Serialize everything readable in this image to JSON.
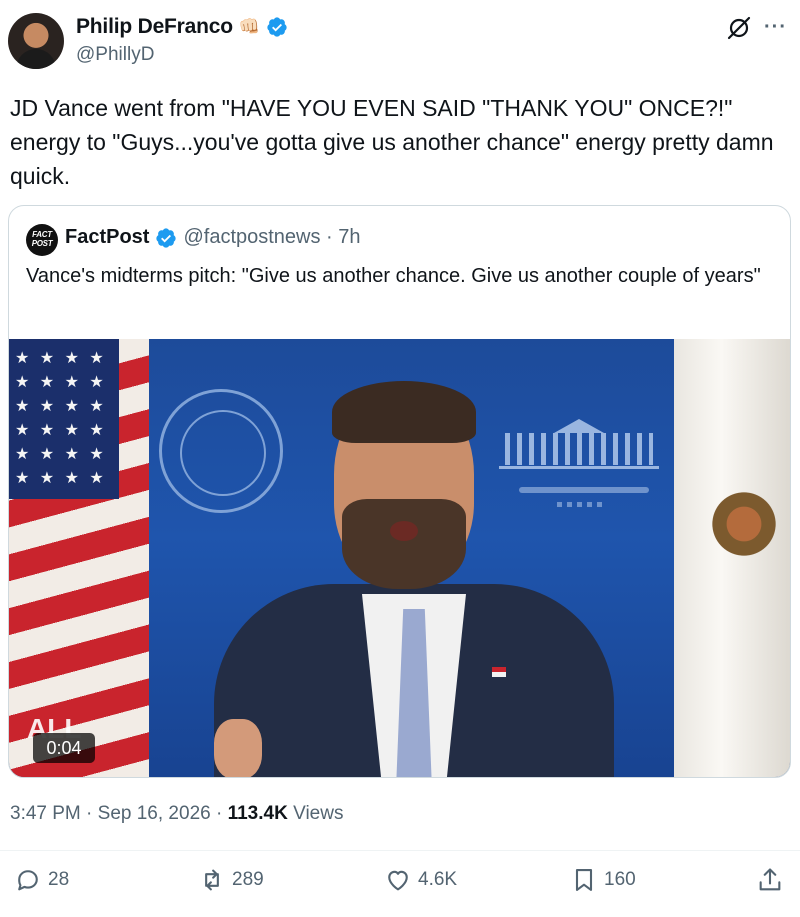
{
  "author": {
    "display_name": "Philip DeFranco",
    "emoji": "👊🏻",
    "handle": "@PhillyD",
    "verified": true
  },
  "tweet": {
    "text": "JD Vance went from \"HAVE YOU EVEN SAID \"THANK YOU\" ONCE?!\" energy to \"Guys...you've gotta give us another chance\" energy pretty damn quick."
  },
  "quote": {
    "avatar_text": "FACT POST",
    "display_name": "FactPost",
    "handle_time": "@factpostnews · 7h",
    "text": "Vance's midterms pitch: \"Give us another chance. Give us another couple of years\"",
    "video": {
      "watermark": "ALL",
      "duration": "0:04"
    }
  },
  "meta": {
    "time": "3:47 PM",
    "date": "Sep 16, 2026",
    "views_count": "113.4K",
    "views_label": "Views",
    "separator": "·"
  },
  "actions": {
    "replies": "28",
    "reposts": "289",
    "likes": "4.6K",
    "bookmarks": "160"
  },
  "colors": {
    "verified_blue": "#1d9bf0",
    "secondary_text": "#536471",
    "border": "#cfd9de"
  }
}
